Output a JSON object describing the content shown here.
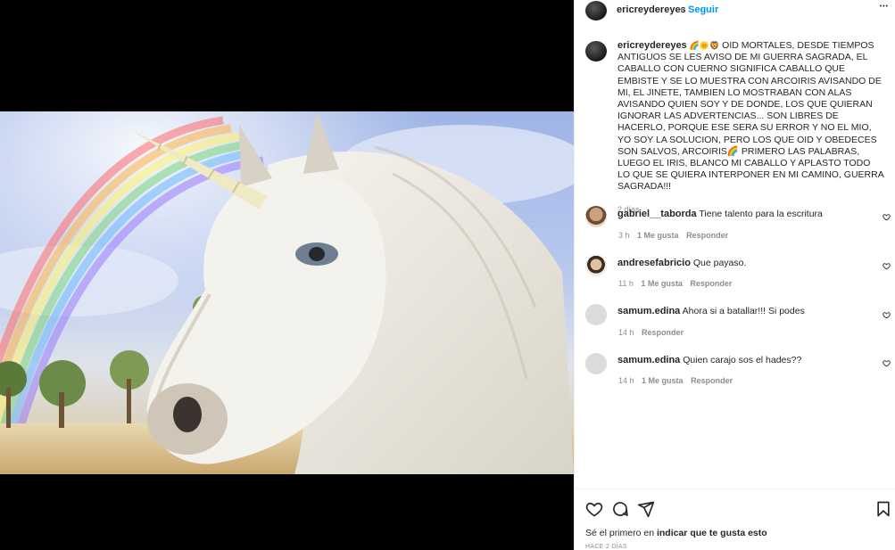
{
  "post": {
    "username": "ericreydereyes",
    "separator": "•",
    "follow_label": "Seguir",
    "more_label": "•••",
    "caption_username": "ericreydereyes",
    "caption_emojis": "🌈🌞🦁",
    "caption_text": "OID MORTALES, DESDE TIEMPOS ANTIGUOS SE LES AVISO DE MI GUERRA SAGRADA, EL CABALLO CON CUERNO SIGNIFICA CABALLO QUE EMBISTE Y SE LO MUESTRA CON ARCOIRIS AVISANDO DE MI, EL JINETE, TAMBIEN LO MOSTRABAN CON ALAS AVISANDO QUIEN SOY Y DE DONDE, LOS QUE QUIERAN IGNORAR LAS ADVERTENCIAS... SON LIBRES DE HACERLO, PORQUE ESE SERA SU ERROR Y NO EL MIO, YO SOY LA SOLUCION, PERO LOS QUE OID Y OBEDECES SON SALVOS, ARCOIRIS🌈 PRIMERO LAS PALABRAS, LUEGO EL IRIS, BLANCO MI CABALLO Y APLASTO TODO LO QUE SE QUIERA INTERPONER EN MI CAMINO, GUERRA SAGRADA!!!",
    "caption_time": "2 días"
  },
  "comments": [
    {
      "username": "gabriel__taborda",
      "text": "Tiene talento para la escritura",
      "time": "3 h",
      "likes": "1 Me gusta",
      "reply": "Responder"
    },
    {
      "username": "andresefabricio",
      "text": "Que payaso.",
      "time": "11 h",
      "likes": "1 Me gusta",
      "reply": "Responder"
    },
    {
      "username": "samum.edina",
      "text": "Ahora si a batallar!!! Si podes",
      "time": "14 h",
      "likes": "",
      "reply": "Responder"
    },
    {
      "username": "samum.edina",
      "text": "Quien carajo sos el hades??",
      "time": "14 h",
      "likes": "1 Me gusta",
      "reply": "Responder"
    }
  ],
  "footer": {
    "likes_prefix": "Sé el primero en ",
    "likes_link": "indicar que te gusta esto",
    "date": "HACE 2 DÍAS"
  },
  "icons": {
    "like": "heart-icon",
    "comment": "comment-icon",
    "share": "send-icon",
    "save": "bookmark-icon"
  },
  "colors": {
    "accent": "#0095f6",
    "text": "#262626",
    "muted": "#8e8e8e"
  }
}
